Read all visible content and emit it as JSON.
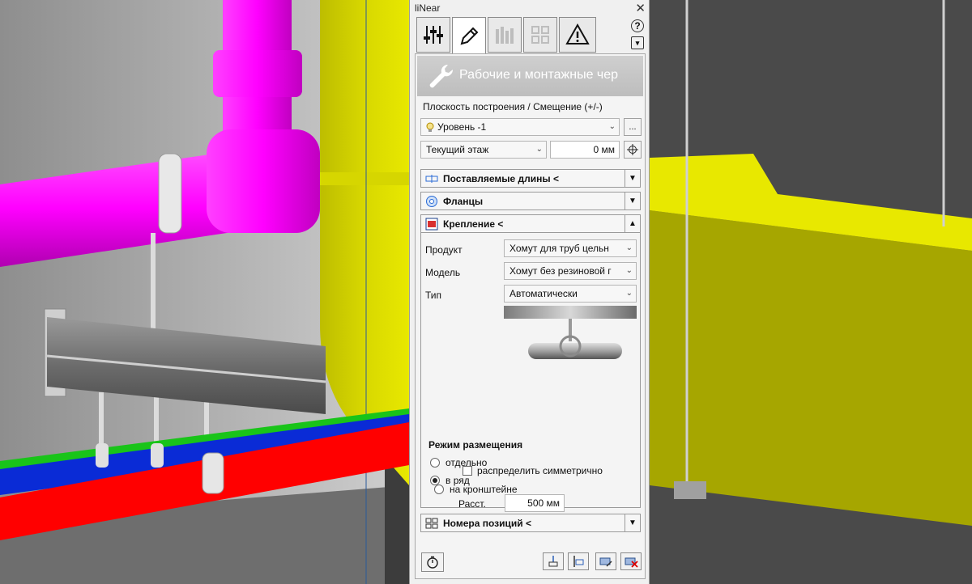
{
  "window": {
    "title": "liNear",
    "close_glyph": "✕"
  },
  "tabs": [
    {
      "name": "settings-sliders-icon",
      "active": false
    },
    {
      "name": "pencil-icon",
      "active": true
    },
    {
      "name": "bar-chart-icon",
      "active": false
    },
    {
      "name": "grid-icon",
      "active": false
    },
    {
      "name": "warning-icon",
      "active": false
    }
  ],
  "side": {
    "help": "?",
    "menu": "▾"
  },
  "banner": {
    "icon": "wrench-icon",
    "text": "Рабочие и монтажные чер"
  },
  "plane": {
    "label": "Плоскость построения / Смещение (+/-)",
    "level_value": "Уровень -1",
    "more": "...",
    "floor_value": "Текущий этаж",
    "offset_value": "0 мм"
  },
  "sections": {
    "lengths": "Поставляемые длины <",
    "flanges": "Фланцы",
    "fixing": "Крепление <",
    "positions": "Номера позиций <"
  },
  "fixing": {
    "product_label": "Продукт",
    "product_value": "Хомут для труб цельн",
    "model_label": "Модель",
    "model_value": "Хомут без резиновой г",
    "type_label": "Тип",
    "type_value": "Автоматически"
  },
  "placement": {
    "title": "Режим размещения",
    "opt_separate": "отдельно",
    "opt_row": "в ряд",
    "selected": "в ряд",
    "distance_label": "Расст.",
    "distance_value": "500 мм",
    "symmetric_label": "распределить симметрично",
    "symmetric_checked": false,
    "opt_bracket": "на кронштейне"
  },
  "colors": {
    "magenta": "#ff00ff",
    "yellow": "#e6e600",
    "red": "#ff0000",
    "blue": "#0a2bd6",
    "green": "#19c419"
  }
}
